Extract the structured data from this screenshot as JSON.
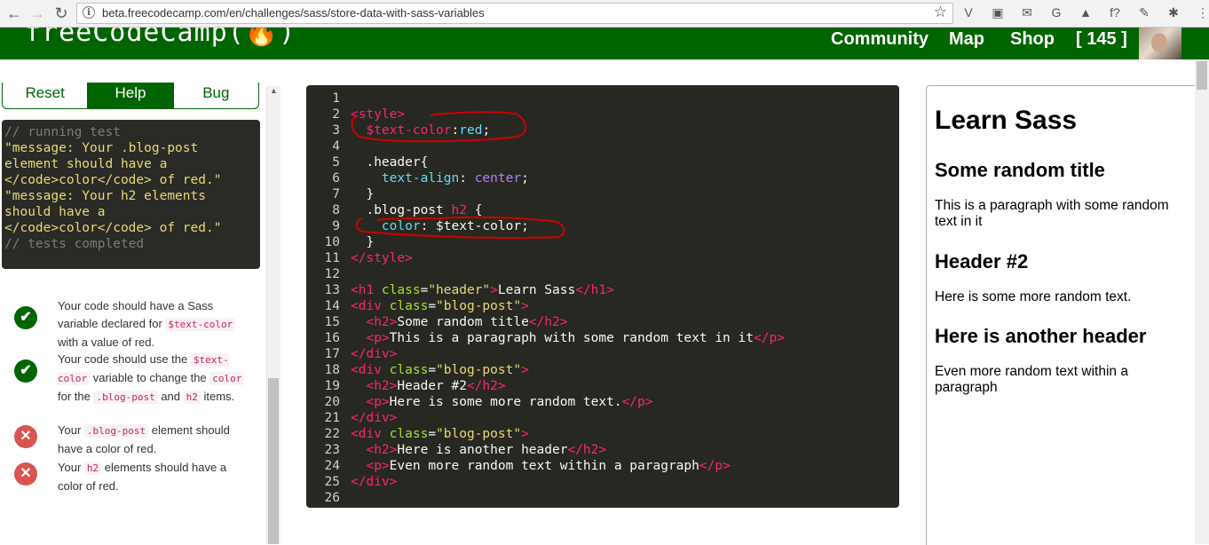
{
  "browser": {
    "url": "beta.freecodecamp.com/en/challenges/sass/store-data-with-sass-variables",
    "extensions": [
      "V",
      "▣",
      "✉",
      "G",
      "▲",
      "f?",
      "✎",
      "✱",
      "⋮"
    ]
  },
  "nav": {
    "logo": "freeCodeCamp(🔥)",
    "links": [
      "Community",
      "Map",
      "Shop",
      "[ 145 ]"
    ]
  },
  "controls": {
    "reset": "Reset",
    "help": "Help",
    "bug": "Bug"
  },
  "console": [
    {
      "cls": "c",
      "text": "// running test"
    },
    {
      "cls": "y",
      "text": "\"message: Your .blog-post"
    },
    {
      "cls": "y",
      "text": "element should have a"
    },
    {
      "cls": "y",
      "text": "</code>color</code> of red.\""
    },
    {
      "cls": "y",
      "text": "\"message: Your h2 elements"
    },
    {
      "cls": "y",
      "text": "should have a"
    },
    {
      "cls": "y",
      "text": "</code>color</code> of red.\""
    },
    {
      "cls": "c",
      "text": "// tests completed"
    }
  ],
  "tests": [
    {
      "status": "pass",
      "icon": "✔",
      "html": "Your code should have a Sass variable declared for <code>$text-color</code> with a value of red."
    },
    {
      "status": "pass",
      "icon": "✔",
      "html": "Your code should use the <code>$text-color</code> variable to change the <code>color</code> for the <code>.blog-post</code> and <code>h2</code> items."
    },
    {
      "status": "fail",
      "icon": "✕",
      "html": "Your <code>.blog-post</code> element should have a color of red."
    },
    {
      "status": "fail",
      "icon": "✕",
      "html": "Your <code>h2</code> elements should have a color of red."
    }
  ],
  "code_lines": [
    [],
    [
      [
        "t-tag",
        "<style>"
      ]
    ],
    [
      [
        "",
        "  "
      ],
      [
        "t-var",
        "$text-color"
      ],
      [
        "",
        ":"
      ],
      [
        "t-prop",
        "red"
      ],
      [
        "",
        ";"
      ]
    ],
    [],
    [
      [
        "",
        "  .header{"
      ]
    ],
    [
      [
        "",
        "    "
      ],
      [
        "t-prop",
        "text-align"
      ],
      [
        "",
        ": "
      ],
      [
        "t-val",
        "center"
      ],
      [
        "",
        ";"
      ]
    ],
    [
      [
        "",
        "  }"
      ]
    ],
    [
      [
        "",
        "  .blog-post "
      ],
      [
        "t-tag",
        "h2"
      ],
      [
        "",
        ""
      ],
      [
        "",
        ""
      ],
      [
        "",
        ""
      ],
      [
        "",
        ""
      ],
      [
        "",
        ""
      ],
      [
        "",
        ""
      ],
      [
        "",
        ""
      ],
      [
        "",
        ""
      ],
      [
        "",
        ""
      ],
      [
        "",
        ""
      ],
      [
        "",
        ""
      ],
      [
        "",
        ""
      ],
      [
        "",
        ""
      ],
      [
        "",
        ""
      ],
      [
        "",
        ""
      ],
      [
        "",
        ""
      ],
      [
        "",
        ""
      ],
      [
        "",
        ""
      ],
      [
        "",
        ""
      ],
      [
        "",
        ""
      ],
      [
        "",
        ""
      ],
      [
        "",
        ""
      ],
      [
        "",
        ""
      ],
      [
        "",
        ""
      ],
      [
        "",
        ""
      ],
      [
        "",
        ""
      ],
      [
        "",
        ""
      ],
      [
        "",
        ""
      ],
      [
        "",
        ""
      ],
      [
        "",
        ""
      ],
      [
        "",
        ""
      ],
      [
        "",
        ""
      ],
      [
        "",
        ""
      ],
      [
        "",
        ""
      ],
      [
        "",
        ""
      ],
      [
        "",
        ""
      ],
      [
        "",
        ""
      ],
      [
        "",
        ""
      ],
      [
        "",
        ""
      ],
      [
        "",
        ""
      ],
      [
        "",
        ""
      ],
      [
        "",
        ""
      ],
      [
        "",
        ""
      ],
      [
        "",
        ""
      ],
      [
        "",
        ""
      ],
      [
        "",
        ""
      ],
      [
        "",
        ""
      ],
      [
        "",
        ""
      ],
      [
        "",
        ""
      ],
      [
        "",
        ""
      ],
      [
        "",
        ""
      ],
      [
        "",
        ""
      ],
      [
        "",
        ""
      ],
      [
        "",
        ""
      ],
      [
        "",
        ""
      ],
      [
        "",
        ""
      ],
      [
        "",
        ""
      ],
      [
        "",
        ""
      ],
      [
        "",
        ""
      ],
      [
        "",
        ""
      ],
      [
        "",
        ""
      ],
      [
        "",
        ""
      ],
      [
        "",
        ""
      ],
      [
        "",
        ""
      ],
      [
        "",
        ""
      ],
      [
        "",
        ""
      ],
      [
        "",
        ""
      ],
      [
        "",
        ""
      ],
      [
        "",
        ""
      ],
      [
        "",
        ""
      ],
      [
        "",
        ""
      ],
      [
        "",
        ""
      ],
      [
        "",
        ""
      ],
      [
        "",
        ""
      ],
      [
        "",
        ""
      ],
      [
        "",
        ""
      ],
      [
        "",
        ""
      ],
      [
        "",
        ""
      ],
      [
        "",
        ""
      ],
      [
        "",
        ""
      ],
      [
        "",
        ""
      ],
      [
        "",
        ""
      ],
      [
        "",
        ""
      ],
      [
        "",
        ""
      ],
      [
        "",
        ""
      ],
      [
        "",
        ""
      ],
      [
        "",
        ""
      ],
      [
        "",
        ""
      ],
      [
        "",
        ""
      ],
      [
        "",
        ""
      ],
      [
        "",
        ""
      ],
      [
        "",
        ""
      ],
      [
        "",
        ""
      ],
      [
        "",
        ""
      ],
      [
        "",
        ""
      ],
      [
        "",
        ""
      ],
      [
        "",
        ""
      ],
      [
        "",
        ""
      ],
      [
        "",
        ""
      ],
      [
        "",
        ""
      ],
      [
        "",
        ""
      ],
      [
        "",
        ""
      ],
      [
        "",
        ""
      ],
      [
        "",
        ""
      ],
      [
        "",
        ""
      ],
      [
        "",
        ""
      ],
      [
        "",
        ""
      ],
      [
        "",
        ""
      ],
      [
        "",
        ""
      ],
      [
        "",
        ""
      ],
      [
        "",
        ""
      ],
      [
        "",
        ""
      ],
      [
        "",
        ""
      ],
      [
        "",
        ""
      ],
      [
        "",
        ""
      ],
      [
        "",
        ""
      ],
      [
        "",
        ""
      ],
      [
        "",
        ""
      ],
      [
        "",
        ""
      ],
      [
        "",
        " {"
      ]
    ],
    [
      [
        "",
        "    "
      ],
      [
        "t-prop",
        "color"
      ],
      [
        "",
        ": $text-color;"
      ]
    ],
    [
      [
        "",
        "  }"
      ]
    ],
    [
      [
        "t-tag",
        "</style>"
      ]
    ],
    [],
    [
      [
        "t-tag",
        "<h1"
      ],
      [
        "",
        ""
      ],
      [
        "t-attr",
        " class"
      ],
      [
        "",
        "="
      ],
      [
        "t-str",
        "\"header\""
      ],
      [
        "t-tag",
        ">"
      ],
      [
        "",
        "Learn Sass"
      ],
      [
        "t-tag",
        "</h1>"
      ]
    ],
    [
      [
        "t-tag",
        "<div"
      ],
      [
        "t-attr",
        " class"
      ],
      [
        "",
        "="
      ],
      [
        "t-str",
        "\"blog-post\""
      ],
      [
        "t-tag",
        ">"
      ]
    ],
    [
      [
        "",
        "  "
      ],
      [
        "t-tag",
        "<h2>"
      ],
      [
        "",
        "Some random title"
      ],
      [
        "t-tag",
        "</h2>"
      ]
    ],
    [
      [
        "",
        "  "
      ],
      [
        "t-tag",
        "<p>"
      ],
      [
        "",
        "This is a paragraph with some random text in it"
      ],
      [
        "t-tag",
        "</p>"
      ]
    ],
    [
      [
        "t-tag",
        "</div>"
      ]
    ],
    [
      [
        "t-tag",
        "<div"
      ],
      [
        "t-attr",
        " class"
      ],
      [
        "",
        "="
      ],
      [
        "t-str",
        "\"blog-post\""
      ],
      [
        "t-tag",
        ">"
      ]
    ],
    [
      [
        "",
        "  "
      ],
      [
        "t-tag",
        "<h2>"
      ],
      [
        "",
        "Header #2"
      ],
      [
        "t-tag",
        "</h2>"
      ]
    ],
    [
      [
        "",
        "  "
      ],
      [
        "t-tag",
        "<p>"
      ],
      [
        "",
        "Here is some more random text."
      ],
      [
        "t-tag",
        "</p>"
      ]
    ],
    [
      [
        "t-tag",
        "</div>"
      ]
    ],
    [
      [
        "t-tag",
        "<div"
      ],
      [
        "t-attr",
        " class"
      ],
      [
        "",
        "="
      ],
      [
        "t-str",
        "\"blog-post\""
      ],
      [
        "t-tag",
        ">"
      ]
    ],
    [
      [
        "",
        "  "
      ],
      [
        "t-tag",
        "<h2>"
      ],
      [
        "",
        "Here is another header"
      ],
      [
        "t-tag",
        "</h2>"
      ]
    ],
    [
      [
        "",
        "  "
      ],
      [
        "t-tag",
        "<p>"
      ],
      [
        "",
        "Even more random text within a paragraph"
      ],
      [
        "t-tag",
        "</p>"
      ]
    ],
    [
      [
        "t-tag",
        "</div>"
      ]
    ],
    []
  ],
  "preview": {
    "h1": "Learn Sass",
    "posts": [
      {
        "h2": "Some random title",
        "p": "This is a paragraph with some random text in it"
      },
      {
        "h2": "Header #2",
        "p": "Here is some more random text."
      },
      {
        "h2": "Here is another header",
        "p": "Even more random text within a paragraph"
      }
    ]
  },
  "colors": {
    "brand_green": "#006400",
    "editor_bg": "#272822",
    "annotation_red": "#d00000"
  }
}
